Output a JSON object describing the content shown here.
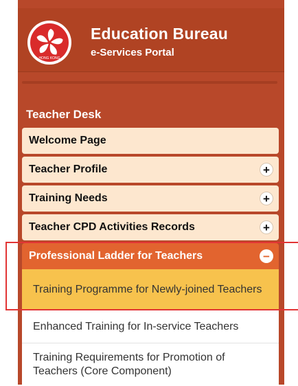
{
  "header": {
    "title": "Education Bureau",
    "subtitle": "e-Services Portal",
    "logo_icon": "hong-kong-bauhinia-emblem",
    "logo_text": "HONG KONG"
  },
  "section": {
    "title": "Teacher Desk"
  },
  "menu": {
    "items": [
      {
        "label": "Welcome Page",
        "toggle": ""
      },
      {
        "label": "Teacher Profile",
        "toggle": "+"
      },
      {
        "label": "Training Needs",
        "toggle": "+"
      },
      {
        "label": "Teacher CPD Activities Records",
        "toggle": "+"
      },
      {
        "label": "Professional Ladder for Teachers",
        "toggle": "−"
      }
    ],
    "subitems": [
      {
        "label": "Training Programme for Newly-joined Teachers"
      },
      {
        "label": "Enhanced Training for In-service Teachers"
      },
      {
        "label": "Training Requirements for Promotion of Teachers (Core Component)"
      }
    ]
  },
  "colors": {
    "panel": "#b8482a",
    "menu_item": "#fde7cf",
    "active_item": "#e2642f",
    "current_subitem": "#f7c24d",
    "highlight": "#e23434"
  }
}
